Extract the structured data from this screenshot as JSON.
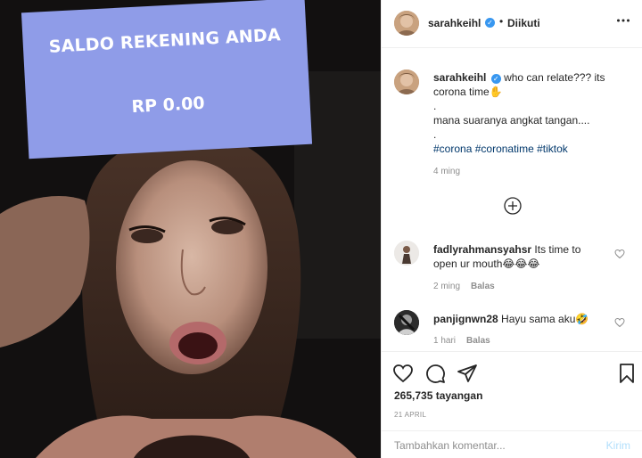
{
  "media": {
    "sticker_title": "SALDO REKENING ANDA",
    "sticker_amount": "RP 0.00"
  },
  "header": {
    "username": "sarahkeihl",
    "separator": "•",
    "follow_status": "Diikuti"
  },
  "caption": {
    "username": "sarahkeihl",
    "text_line1": "who can relate??? its",
    "text_line2": "corona time✋",
    "dot1": ".",
    "text_line3": "mana suaranya angkat tangan....",
    "dot2": ".",
    "hashtags": [
      "#corona",
      "#coronatime",
      "#tiktok"
    ],
    "time": "4 ming"
  },
  "comments": [
    {
      "username": "fadlyrahmansyahsr",
      "text_line1": "Its time to",
      "text_line2": "open ur mouth😂😂😂",
      "time": "2 ming",
      "reply": "Balas"
    },
    {
      "username": "panjignwn28",
      "text": "Hayu sama aku🤣",
      "time": "1 hari",
      "reply": "Balas"
    }
  ],
  "stats": {
    "views": "265,735 tayangan",
    "date": "21 APRIL"
  },
  "comment_box": {
    "placeholder": "Tambahkan komentar...",
    "post_label": "Kirim"
  },
  "colors": {
    "sticker": "#8f9ce8",
    "link": "#00376b",
    "verified": "#3897f0",
    "post_disabled": "#b2dffc"
  }
}
